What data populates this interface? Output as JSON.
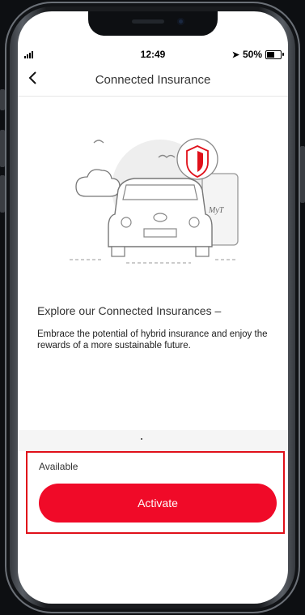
{
  "status_bar": {
    "time": "12:49",
    "battery": "50%"
  },
  "nav": {
    "back_icon": "chevron-left-icon",
    "title": "Connected Insurance"
  },
  "illustration": {
    "badge_text": "MyT"
  },
  "content": {
    "heading": "Explore our Connected Insurances –",
    "body": "Embrace the potential of hybrid insurance and enjoy the rewards of a more sustainable future."
  },
  "activation": {
    "status_label": "Available",
    "button_label": "Activate"
  },
  "colors": {
    "accent": "#f00a28",
    "highlight_border": "#e0101a"
  }
}
